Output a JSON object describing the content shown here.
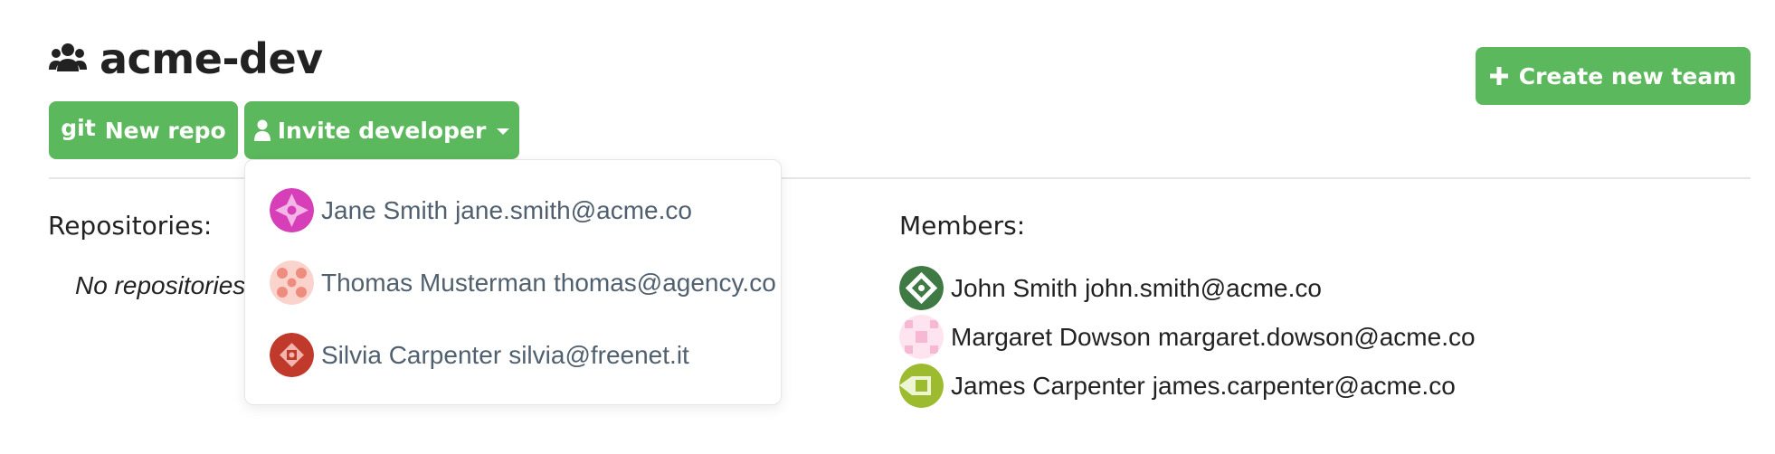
{
  "team": {
    "name": "acme-dev",
    "icon": "users-icon"
  },
  "toolbar": {
    "new_repo_prefix": "git",
    "new_repo_label": "New repo",
    "invite_label": "Invite developer",
    "create_team_label": "Create new team"
  },
  "invite_menu": {
    "items": [
      {
        "name": "Jane Smith",
        "email": "jane.smith@acme.co"
      },
      {
        "name": "Thomas Musterman",
        "email": "thomas@agency.co"
      },
      {
        "name": "Silvia Carpenter",
        "email": "silvia@freenet.it"
      }
    ]
  },
  "repositories": {
    "label": "Repositories:",
    "empty_text": "No repositories"
  },
  "members": {
    "label": "Members:",
    "items": [
      {
        "name": "John Smith",
        "email": "john.smith@acme.co"
      },
      {
        "name": "Margaret Dowson",
        "email": "margaret.dowson@acme.co"
      },
      {
        "name": "James Carpenter",
        "email": "james.carpenter@acme.co"
      }
    ]
  },
  "colors": {
    "accent": "#5cb85c",
    "avatar_jane": "#d63fb7",
    "avatar_thomas": "#ef8c80",
    "avatar_silvia": "#c0392b",
    "avatar_john": "#3f7a44",
    "avatar_margaret": "#f6b8d3",
    "avatar_james": "#9dbb2e"
  }
}
